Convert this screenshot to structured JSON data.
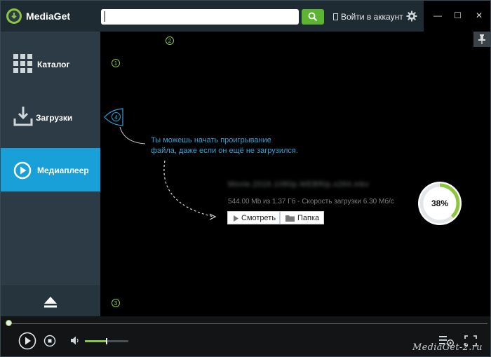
{
  "app": {
    "title": "MediaGet"
  },
  "search": {
    "value": "",
    "placeholder": ""
  },
  "header": {
    "login_label": "Войти в аккаунт"
  },
  "window_controls": {
    "minimize": "—",
    "maximize": "☐",
    "close": "✕"
  },
  "sidebar": {
    "items": [
      {
        "label": "Каталог",
        "icon": "grid-icon",
        "active": false
      },
      {
        "label": "Загрузки",
        "icon": "download-icon",
        "active": false
      },
      {
        "label": "Медиаплеер",
        "icon": "play-circle-icon",
        "active": true
      }
    ],
    "eject_icon": "eject-icon"
  },
  "tutorial": {
    "badges": [
      "1",
      "2",
      "3",
      "4"
    ],
    "tip_lines": [
      "Ты можешь начать проигрывание",
      "файла, даже если он ещё не загрузился."
    ]
  },
  "download": {
    "file_name": "Movie.2016.1080p.WEBRip.x264.mkv",
    "progress_text": "544.00 Mb из 1.37 Гб - Скорость загрузки 6.30 Мб/с",
    "percent_label": "38%",
    "percent": 0.38,
    "watch_label": "Смотреть",
    "folder_label": "Папка"
  },
  "player": {
    "position": 0,
    "volume": 0.5
  },
  "watermark": "MediaGet-2.ru",
  "colors": {
    "accent_green": "#8cc63f",
    "active_blue": "#1aa0d8",
    "tip_blue": "#2ea3d6",
    "sidebar_bg": "#2c3b45"
  }
}
